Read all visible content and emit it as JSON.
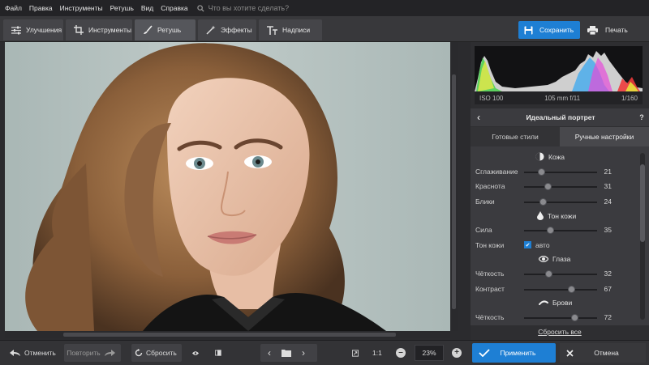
{
  "menu": {
    "items": [
      "Файл",
      "Правка",
      "Инструменты",
      "Ретушь",
      "Вид",
      "Справка"
    ],
    "search_placeholder": "Что вы хотите сделать?",
    "search_icon": "search-icon"
  },
  "toolbar": {
    "tabs": [
      {
        "label": "Улучшения",
        "icon": "sliders-icon"
      },
      {
        "label": "Инструменты",
        "icon": "crop-icon"
      },
      {
        "label": "Ретушь",
        "icon": "brush-icon"
      },
      {
        "label": "Эффекты",
        "icon": "magic-wand-icon"
      },
      {
        "label": "Надписи",
        "icon": "text-icon"
      }
    ],
    "active_tab": "Ретушь",
    "save_label": "Сохранить",
    "print_label": "Печать"
  },
  "histogram": {
    "iso": "ISO 100",
    "lens": "105 mm f/11",
    "shutter": "1/160"
  },
  "panel": {
    "preset_title": "Идеальный портрет",
    "help": "?",
    "tabs": [
      "Готовые стили",
      "Ручные настройки"
    ],
    "active_tab": "Ручные настройки",
    "sections": {
      "skin": "Кожа",
      "skin_tone": "Тон кожи",
      "eyes": "Глаза",
      "brows": "Брови"
    },
    "rows": [
      {
        "label": "Сглаживание",
        "value": "21",
        "level": 0.21
      },
      {
        "label": "Краснота",
        "value": "31",
        "level": 0.31
      },
      {
        "label": "Блики",
        "value": "24",
        "level": 0.24
      },
      {
        "label": "Сила",
        "value": "35",
        "level": 0.35
      },
      {
        "label": "Чёткость",
        "value": "32",
        "level": 0.32
      },
      {
        "label": "Контраст",
        "value": "67",
        "level": 0.67
      },
      {
        "label": "Чёткость",
        "value": "72",
        "level": 0.72
      }
    ],
    "skin_tone_check": {
      "label": "Тон кожи",
      "option": "авто",
      "checked": true
    },
    "reset_all": "Сбросить все"
  },
  "bottom": {
    "undo": "Отменить",
    "redo": "Повторить",
    "reset": "Сбросить",
    "ratio": "1:1",
    "zoom": "23%",
    "apply": "Применить",
    "cancel": "Отмена"
  },
  "colors": {
    "accent": "#1e7fd4",
    "background": "#2b2b2e",
    "panel": "#3b3b3f"
  }
}
